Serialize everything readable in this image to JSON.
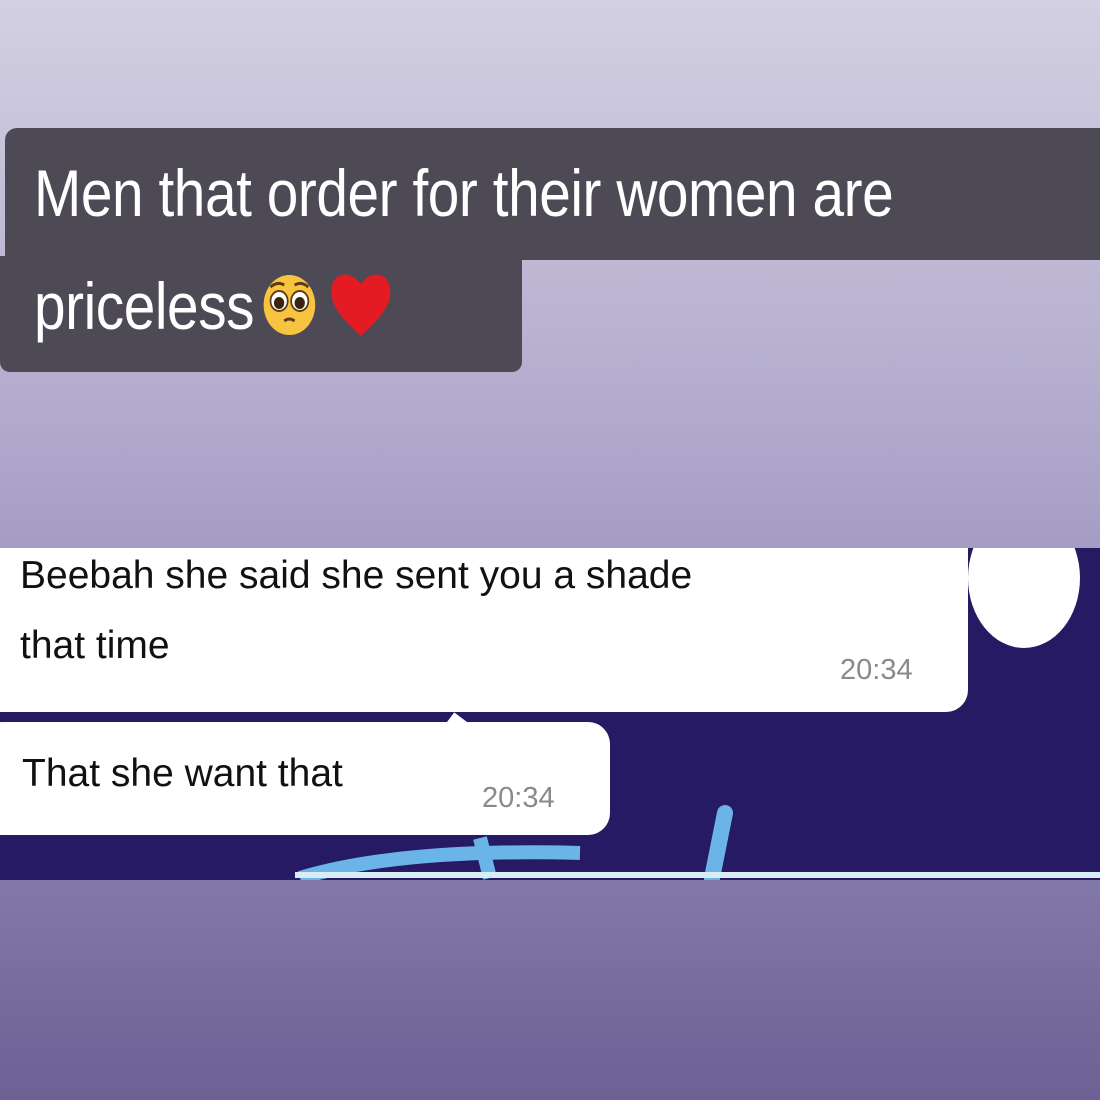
{
  "caption": {
    "line1": "Men that order for their women are",
    "line2": "priceless",
    "emojis": [
      "pleading-face-emoji",
      "red-heart-emoji"
    ]
  },
  "chat": {
    "messages": [
      {
        "line1": "Beebah she said she sent you a shade",
        "line2": "that time",
        "time": "20:34"
      },
      {
        "text": "That she want that",
        "time": "20:34"
      }
    ]
  },
  "colors": {
    "caption_bg": "#4d4a55",
    "chat_bg": "#251a63",
    "bubble": "#ffffff",
    "scribble": "#6ab4e8"
  }
}
